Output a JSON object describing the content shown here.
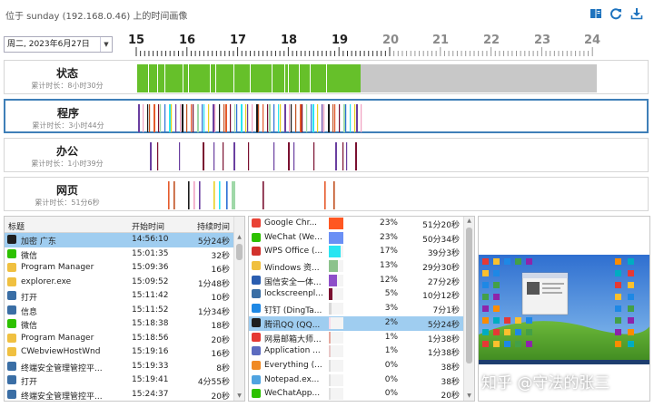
{
  "window": {
    "title": "位于 sunday (192.168.0.46) 上的时间画像"
  },
  "toolbar": {
    "icons": [
      "book-icon",
      "refresh-icon",
      "download-icon"
    ]
  },
  "date_selector": {
    "value": "周二, 2023年6月27日"
  },
  "timeline": {
    "hours": [
      "15",
      "16",
      "17",
      "18",
      "19",
      "20",
      "21",
      "22",
      "23",
      "24"
    ],
    "current_hour_end": "19",
    "lanes": [
      {
        "label": "状态",
        "total": "累计时长：8小时30分"
      },
      {
        "label": "程序",
        "total": "累计时长：3小时44分"
      },
      {
        "label": "办公",
        "total": "累计时长：1小时39分"
      },
      {
        "label": "网页",
        "total": "累计时长：51分6秒"
      }
    ]
  },
  "activity_table": {
    "columns": [
      "标题",
      "开始时间",
      "持续时间"
    ],
    "rows": [
      {
        "icon": "qq-icon",
        "title": "加密 广东",
        "start": "14:56:10",
        "duration": "5分24秒",
        "selected": true
      },
      {
        "icon": "wechat-icon",
        "title": "微信",
        "start": "15:01:35",
        "duration": "32秒"
      },
      {
        "icon": "folder-icon",
        "title": "Program Manager",
        "start": "15:09:36",
        "duration": "16秒"
      },
      {
        "icon": "folder-icon",
        "title": "explorer.exe",
        "start": "15:09:52",
        "duration": "1分48秒"
      },
      {
        "icon": "window-icon",
        "title": "打开",
        "start": "15:11:42",
        "duration": "10秒"
      },
      {
        "icon": "window-icon",
        "title": "信息",
        "start": "15:11:52",
        "duration": "1分34秒"
      },
      {
        "icon": "wechat-icon",
        "title": "微信",
        "start": "15:18:38",
        "duration": "18秒"
      },
      {
        "icon": "folder-icon",
        "title": "Program Manager",
        "start": "15:18:56",
        "duration": "20秒"
      },
      {
        "icon": "folder-icon",
        "title": "CWebviewHostWnd",
        "start": "15:19:16",
        "duration": "16秒"
      },
      {
        "icon": "window-icon",
        "title": "终端安全管理管控平...",
        "start": "15:19:33",
        "duration": "8秒"
      },
      {
        "icon": "window-icon",
        "title": "打开",
        "start": "15:19:41",
        "duration": "4分55秒"
      },
      {
        "icon": "window-icon",
        "title": "终端安全管理管控平...",
        "start": "15:24:37",
        "duration": "20秒"
      }
    ]
  },
  "app_table": {
    "rows": [
      {
        "icon": "chrome-icon",
        "name": "Google Chr...",
        "color": "#ff5722",
        "fill": 1.0,
        "percent": "23%",
        "duration": "51分20秒"
      },
      {
        "icon": "wechat-icon",
        "name": "WeChat (We...",
        "color": "#6a8ff5",
        "fill": 1.0,
        "percent": "23%",
        "duration": "50分34秒"
      },
      {
        "icon": "wps-icon",
        "name": "WPS Office (...",
        "color": "#29e5f2",
        "fill": 0.8,
        "percent": "17%",
        "duration": "39分3秒"
      },
      {
        "icon": "windows-icon",
        "name": "Windows 资...",
        "color": "#8cc28c",
        "fill": 0.65,
        "percent": "13%",
        "duration": "29分30秒"
      },
      {
        "icon": "shield-icon",
        "name": "国信安全一体...",
        "color": "#8e4fc9",
        "fill": 0.55,
        "percent": "12%",
        "duration": "27分2秒"
      },
      {
        "icon": "lock-icon",
        "name": "lockscreenpl...",
        "color": "#7a1030",
        "fill": 0.25,
        "percent": "5%",
        "duration": "10分12秒"
      },
      {
        "icon": "dingtalk-icon",
        "name": "钉钉 (DingTa...",
        "color": "#d7d7d7",
        "fill": 0.18,
        "percent": "3%",
        "duration": "7分1秒"
      },
      {
        "icon": "qq-icon",
        "name": "腾讯QQ (QQ...",
        "color": "#f7d9e8",
        "fill": 0.1,
        "percent": "2%",
        "duration": "5分24秒",
        "selected": true
      },
      {
        "icon": "mail-icon",
        "name": "网易邮箱大师...",
        "color": "#e6aaa0",
        "fill": 0.08,
        "percent": "1%",
        "duration": "1分38秒"
      },
      {
        "icon": "app-icon",
        "name": "Application ...",
        "color": "#e8c8c8",
        "fill": 0.06,
        "percent": "1%",
        "duration": "1分38秒"
      },
      {
        "icon": "search-icon",
        "name": "Everything (...",
        "color": "#dcdcdc",
        "fill": 0.04,
        "percent": "0%",
        "duration": "38秒"
      },
      {
        "icon": "notepad-icon",
        "name": "Notepad.ex...",
        "color": "#e0e0e0",
        "fill": 0.04,
        "percent": "0%",
        "duration": "38秒"
      },
      {
        "icon": "wechat-icon",
        "name": "WeChatApp...",
        "color": "#e0e0e0",
        "fill": 0.03,
        "percent": "0%",
        "duration": "20秒"
      }
    ]
  },
  "screenshot_preview": {
    "caption": "",
    "desktop_icon_count": 52
  },
  "watermark": "知乎 @守法的张三"
}
